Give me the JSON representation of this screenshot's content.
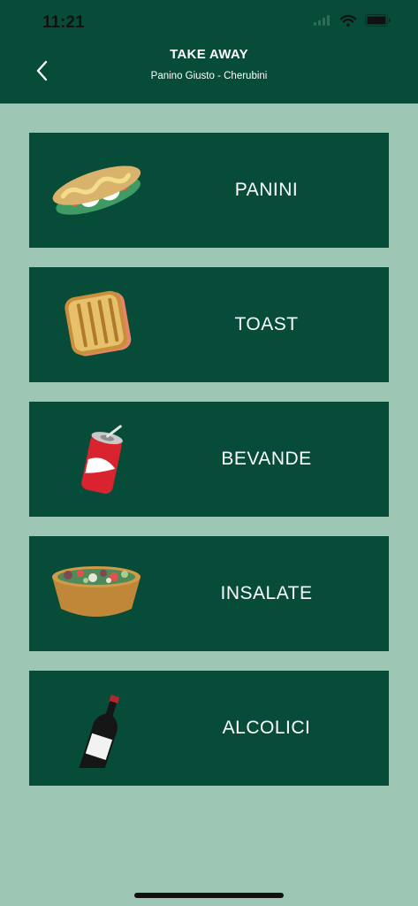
{
  "status_bar": {
    "time": "11:21"
  },
  "header": {
    "title": "TAKE AWAY",
    "subtitle": "Panino Giusto - Cherubini"
  },
  "menu": {
    "items": [
      {
        "label": "PANINI",
        "icon": "sandwich-icon"
      },
      {
        "label": "TOAST",
        "icon": "toast-icon"
      },
      {
        "label": "BEVANDE",
        "icon": "soda-can-icon"
      },
      {
        "label": "INSALATE",
        "icon": "salad-bowl-icon"
      },
      {
        "label": "ALCOLICI",
        "icon": "wine-bottle-icon"
      }
    ]
  },
  "colors": {
    "header_bg": "#074c39",
    "card_bg": "#074c39",
    "page_bg": "#9ec6b5",
    "text": "#ffffff"
  }
}
